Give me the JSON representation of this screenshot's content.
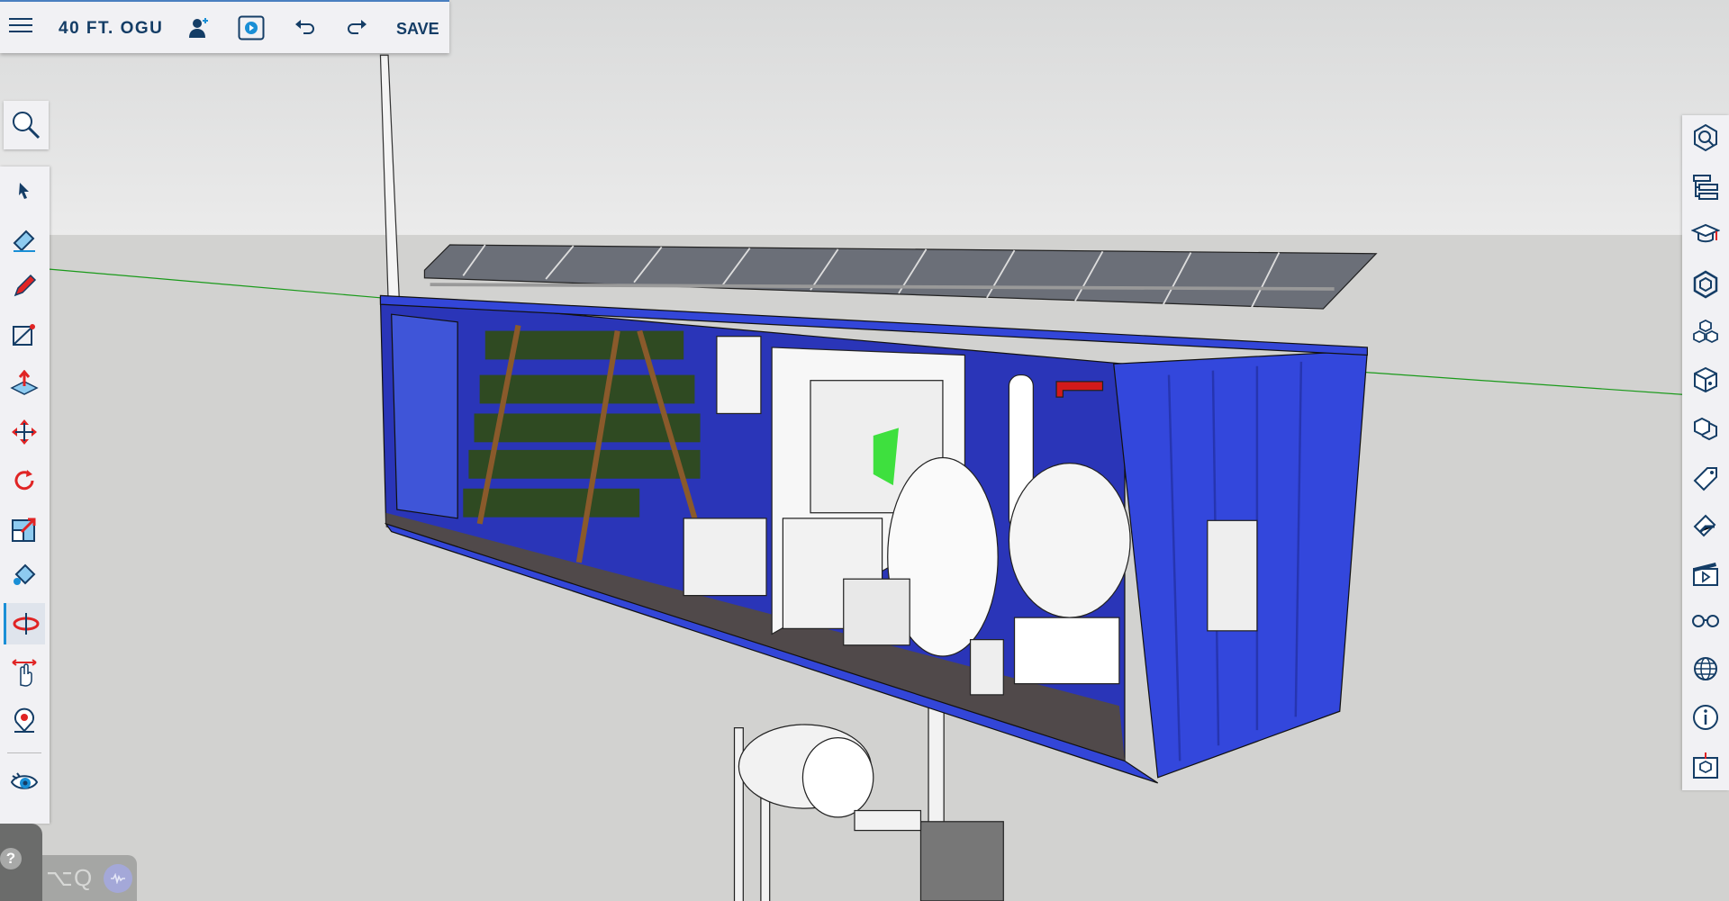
{
  "app": {
    "title": "40 FT. OGU",
    "save_label": "SAVE",
    "help_label": "?",
    "shortcut_label": "⌥Q"
  },
  "colors": {
    "accent": "#1a8fd6",
    "navy": "#143d66",
    "container": "#3346d8",
    "toolbar": "#f1f1f4"
  },
  "topbar_icons": [
    "menu-icon",
    "add-collaborator-icon",
    "present-icon",
    "undo-icon",
    "redo-icon"
  ],
  "left_tools": [
    "select",
    "eraser",
    "pencil",
    "line",
    "push-pull",
    "move",
    "rotate",
    "scale",
    "paint-bucket",
    "orbit",
    "pan",
    "position-camera",
    "walk"
  ],
  "right_panels": [
    "entity-info",
    "outliner",
    "instructor",
    "components",
    "materials",
    "styles",
    "scenes-3d",
    "tags",
    "soften-edges",
    "scenes",
    "display",
    "geo-location",
    "model-info",
    "solid-inspector"
  ]
}
